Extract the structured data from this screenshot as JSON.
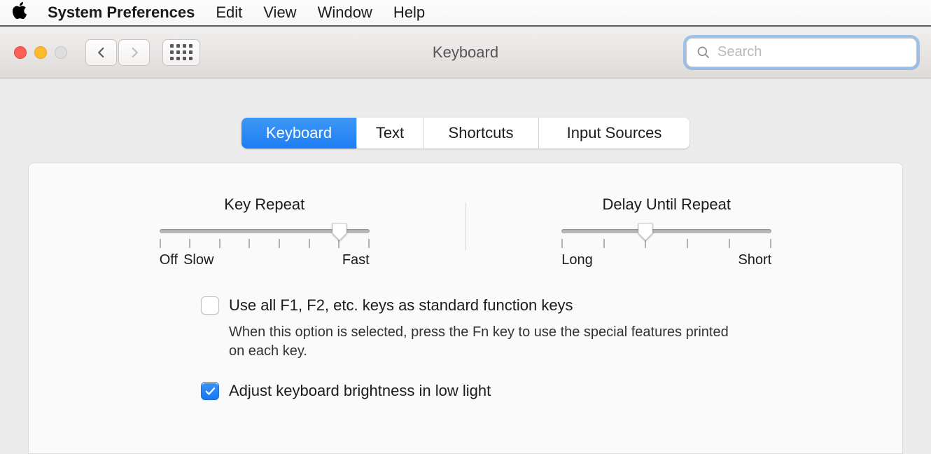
{
  "menubar": {
    "app": "System Preferences",
    "items": [
      "Edit",
      "View",
      "Window",
      "Help"
    ]
  },
  "toolbar": {
    "window_title": "Keyboard",
    "search_placeholder": "Search"
  },
  "tabs": [
    {
      "label": "Keyboard",
      "active": true
    },
    {
      "label": "Text",
      "active": false
    },
    {
      "label": "Shortcuts",
      "active": false
    },
    {
      "label": "Input Sources",
      "active": false
    }
  ],
  "sliders": {
    "key_repeat": {
      "title": "Key Repeat",
      "left_label_a": "Off",
      "left_label_b": "Slow",
      "right_label": "Fast",
      "ticks": 8,
      "value_index": 6
    },
    "delay_until_repeat": {
      "title": "Delay Until Repeat",
      "left_label": "Long",
      "right_label": "Short",
      "ticks": 6,
      "value_index": 2
    }
  },
  "options": {
    "fn_keys": {
      "checked": false,
      "label": "Use all F1, F2, etc. keys as standard function keys",
      "desc": "When this option is selected, press the Fn key to use the special features printed on each key."
    },
    "brightness": {
      "checked": true,
      "label": "Adjust keyboard brightness in low light"
    }
  }
}
